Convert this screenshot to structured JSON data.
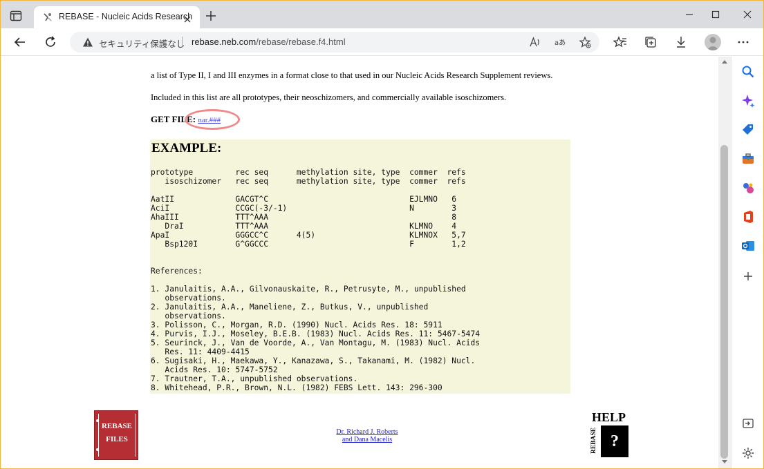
{
  "browser": {
    "tab_title": "REBASE - Nucleic Acids Research",
    "security_label": "セキュリティ保護なし",
    "url_host": "rebase.neb.com",
    "url_path": "/rebase/rebase.f4.html"
  },
  "page": {
    "intro": "a list of Type II, I and III enzymes in a format close to that used in our Nucleic Acids Research Supplement reviews.",
    "included": "Included in this list are all prototypes, their neoschizomers, and commercially available isoschizomers.",
    "get_file_label": "GET FILE:",
    "get_file_link": "nar.###",
    "example_title": "EXAMPLE:",
    "header_lines": [
      "prototype         rec seq      methylation site, type  commer  refs",
      "   isoschizomer   rec seq      methylation site, type  commer  refs"
    ],
    "enzymes": [
      "AatII             GACGT^C                              EJLMNO   6",
      "AciI              CCGC(-3/-1)                          N        3",
      "AhaIII            TTT^AAA                                       8",
      "   DraI           TTT^AAA                              KLMNO    4",
      "ApaI              GGGCC^C      4(5)                    KLMNOX   5,7",
      "   Bsp120I        G^GGCCC                              F        1,2"
    ],
    "references_label": "References:",
    "references": [
      "1. Janulaitis, A.A., Gilvonauskaite, R., Petrusyte, M., unpublished",
      "   observations.",
      "2. Janulaitis, A.A., Maneliene, Z., Butkus, V., unpublished",
      "   observations.",
      "3. Polisson, C., Morgan, R.D. (1990) Nucl. Acids Res. 18: 5911",
      "4. Purvis, I.J., Moseley, B.E.B. (1983) Nucl. Acids Res. 11: 5467-5474",
      "5. Seurinck, J., Van de Voorde, A., Van Montagu, M. (1983) Nucl. Acids",
      "   Res. 11: 4409-4415",
      "6. Sugisaki, H., Maekawa, Y., Kanazawa, S., Takanami, M. (1982) Nucl.",
      "   Acids Res. 10: 5747-5752",
      "7. Trautner, T.A., unpublished observations.",
      "8. Whitehead, P.R., Brown, N.L. (1982) FEBS Lett. 143: 296-300"
    ],
    "rebase_files_line1": "REBASE",
    "rebase_files_line2": "FILES",
    "credit_line1": "Dr. Richard J. Roberts",
    "credit_line2": "and Dana Macelis",
    "help_word": "HELP",
    "help_rebase": "REBASE",
    "help_mark": "?"
  }
}
